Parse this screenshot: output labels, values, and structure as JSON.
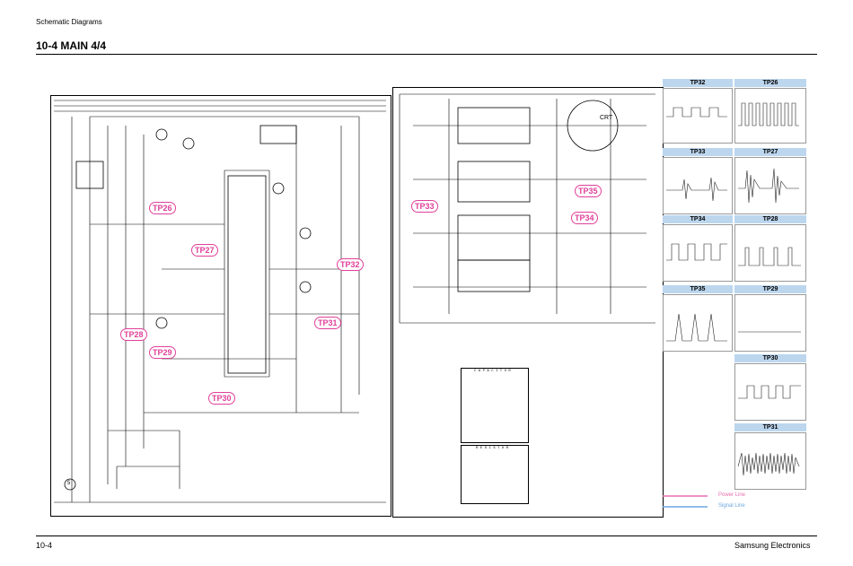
{
  "header": {
    "section": "Schematic Diagrams",
    "title": "10-4 MAIN 4/4"
  },
  "footer": {
    "page": "10-4",
    "company": "Samsung Electronics"
  },
  "testpoints": {
    "tp26": "TP26",
    "tp27": "TP27",
    "tp28": "TP28",
    "tp29": "TP29",
    "tp30": "TP30",
    "tp31": "TP31",
    "tp32": "TP32",
    "tp33": "TP33",
    "tp34": "TP34",
    "tp35": "TP35"
  },
  "waveforms": {
    "tp32": "TP32",
    "tp26": "TP26",
    "tp33": "TP33",
    "tp27": "TP27",
    "tp34": "TP34",
    "tp28": "TP28",
    "tp35": "TP35",
    "tp29": "TP29",
    "tp30": "TP30",
    "tp31": "TP31"
  },
  "legend": {
    "power": "Power Line",
    "signal": "Signal Line"
  },
  "labels": {
    "crt": "CRT",
    "circle": "5"
  },
  "tables": {
    "capacitor_title": "C A P A C I T O R",
    "resistor_title": "R E S I S T O R"
  },
  "colors": {
    "testpoint": "#e0409a",
    "panel_head": "#bcd6ee",
    "power_line": "#e86fb0",
    "signal_line": "#6aa7e0"
  }
}
